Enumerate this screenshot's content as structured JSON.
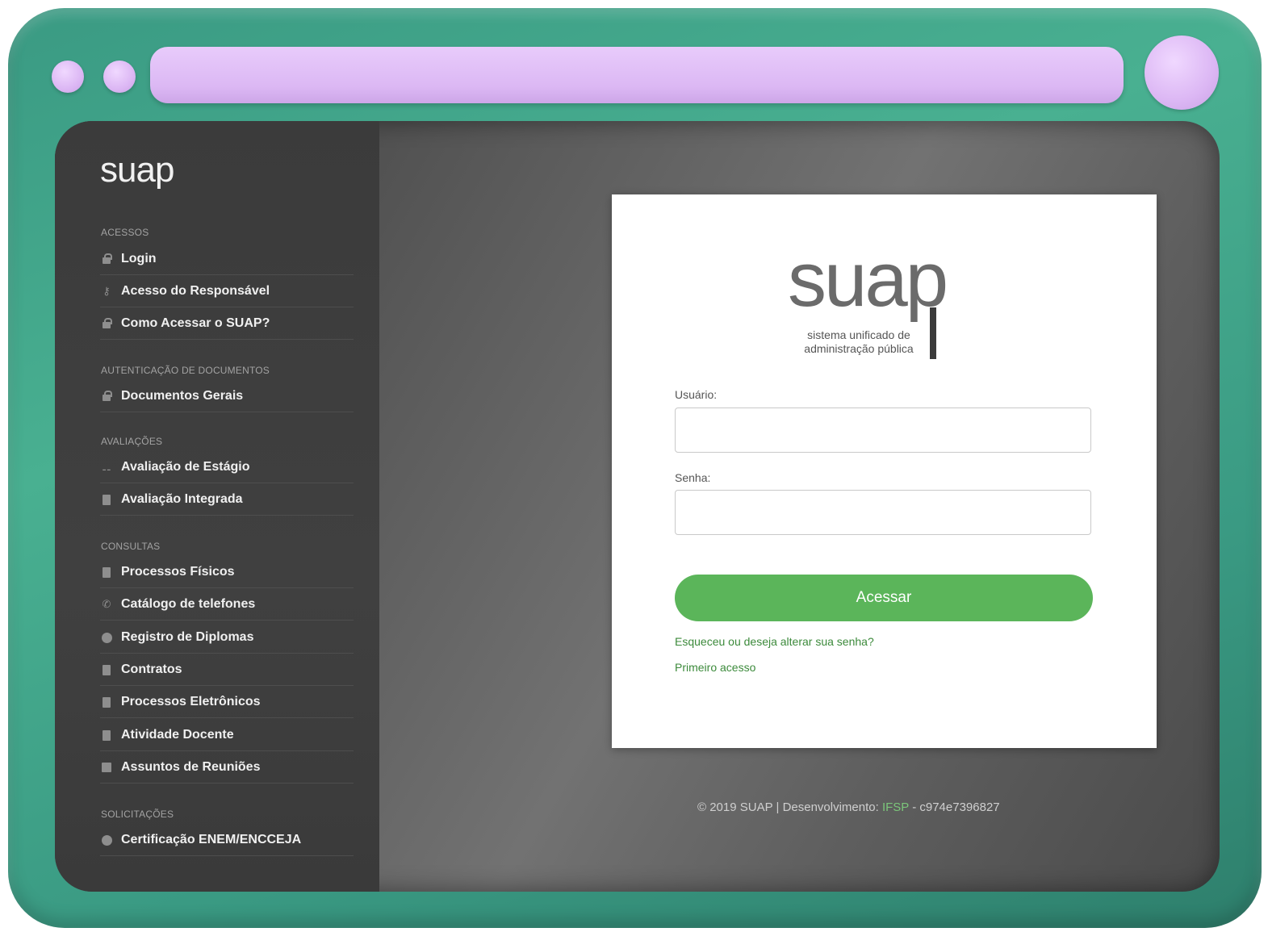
{
  "sidebar": {
    "brand": "suap",
    "sections": [
      {
        "title": "ACESSOS"
      },
      {
        "title": "AUTENTICAÇÃO DE DOCUMENTOS"
      },
      {
        "title": "AVALIAÇÕES"
      },
      {
        "title": "CONSULTAS"
      },
      {
        "title": "SOLICITAÇÕES"
      }
    ],
    "items": [
      {
        "label": "Login",
        "icon": "lock-icon"
      },
      {
        "label": "Acesso do Responsável",
        "icon": "key-icon"
      },
      {
        "label": "Como Acessar o SUAP?",
        "icon": "lock-icon"
      },
      {
        "label": "Documentos Gerais",
        "icon": "lock-icon"
      },
      {
        "label": "Avaliação de Estágio",
        "icon": "chart-icon"
      },
      {
        "label": "Avaliação Integrada",
        "icon": "document-icon"
      },
      {
        "label": "Processos Físicos",
        "icon": "document-icon"
      },
      {
        "label": "Catálogo de telefones",
        "icon": "phone-icon"
      },
      {
        "label": "Registro de Diplomas",
        "icon": "circle-icon"
      },
      {
        "label": "Contratos",
        "icon": "document-icon"
      },
      {
        "label": "Processos Eletrônicos",
        "icon": "document-icon"
      },
      {
        "label": "Atividade Docente",
        "icon": "document-icon"
      },
      {
        "label": "Assuntos de Reuniões",
        "icon": "grid-icon"
      },
      {
        "label": "Certificação ENEM/ENCCEJA",
        "icon": "circle-icon"
      }
    ]
  },
  "login": {
    "logo_main": "suap",
    "logo_sub_1": "sistema unificado de",
    "logo_sub_2": "administração pública",
    "user_label": "Usuário:",
    "password_label": "Senha:",
    "submit": "Acessar",
    "forgot_link": "Esqueceu ou deseja alterar sua senha?",
    "first_access_link": "Primeiro acesso"
  },
  "footer": {
    "prefix": "© 2019 SUAP | Desenvolvimento: ",
    "org": "IFSP",
    "suffix": " - c974e7396827"
  },
  "colors": {
    "frame": "#49b091",
    "accent_purple": "#dcb8f4",
    "button_green": "#5bb55a",
    "link_green": "#3c8a3b"
  }
}
